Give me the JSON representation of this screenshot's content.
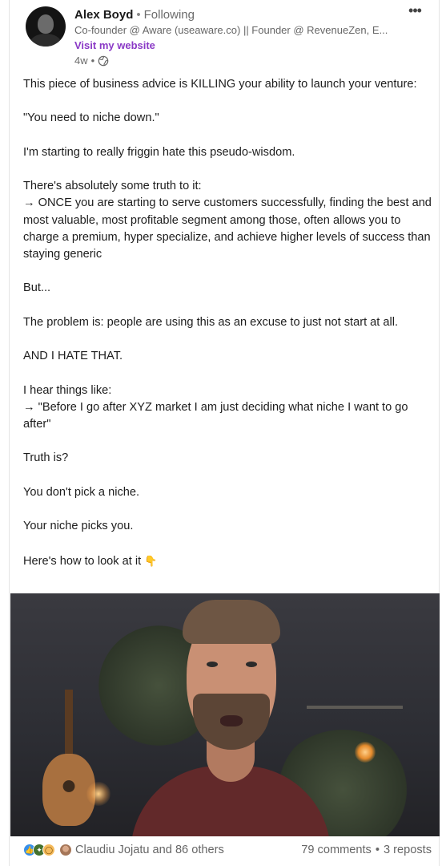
{
  "author": {
    "name": "Alex Boyd",
    "separator": "•",
    "following": "Following",
    "headline": "Co-founder @ Aware (useaware.co) || Founder @ RevenueZen, E...",
    "website_link": "Visit my website",
    "time_ago": "4w",
    "meta_separator": "•",
    "visibility_icon": "globe-icon"
  },
  "menu": {
    "more_label": "•••"
  },
  "post": {
    "paragraphs": [
      "This piece of business advice is KILLING your ability to launch your venture:",
      "\"You need to niche down.\"",
      "I'm starting to really friggin hate this pseudo-wisdom.",
      "There's absolutely some truth to it:\n→ ONCE you are starting to serve customers successfully, finding the best and most valuable, most profitable segment among those, often allows you to charge a premium, hyper specialize, and achieve higher levels of success than staying generic",
      "But...",
      "The problem is: people are using this as an excuse to just not start at all.",
      "AND I HATE THAT.",
      "I hear things like:\n→ \"Before I go after XYZ market I am just deciding what niche I want to go after\"",
      "Truth is?",
      "You don't pick a niche.",
      "Your niche picks you."
    ],
    "closing_line": "Here's how to look at it",
    "closing_emoji": "👇"
  },
  "social": {
    "reaction_icons": [
      "like-icon",
      "celebrate-icon",
      "insightful-icon"
    ],
    "reactions_text": "Claudiu Jojatu and 86 others",
    "comments": "79 comments",
    "separator": "•",
    "reposts": "3 reposts"
  },
  "colors": {
    "link_purple": "#8a39c6",
    "like_blue": "#378fe9",
    "celebrate_green": "#44712e",
    "insightful_yellow": "#f5bb5c"
  }
}
